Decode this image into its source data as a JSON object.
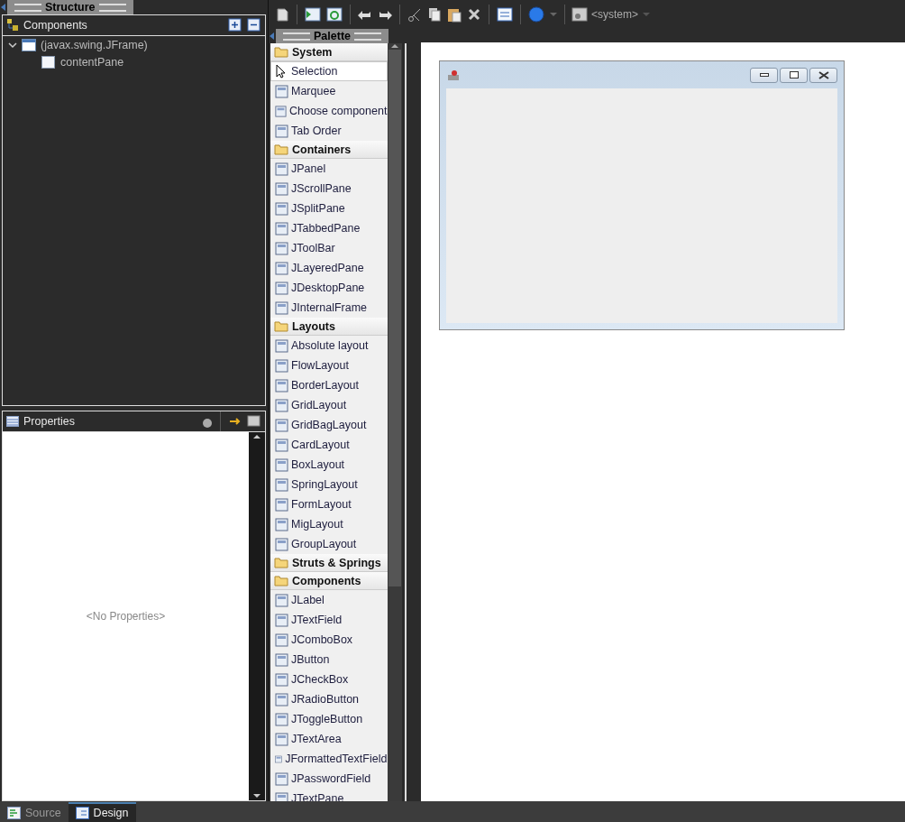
{
  "structure": {
    "title": "Structure",
    "components_title": "Components",
    "tree": [
      {
        "label": "(javax.swing.JFrame)",
        "expanded": true,
        "children": [
          {
            "label": "contentPane"
          }
        ]
      }
    ]
  },
  "properties": {
    "title": "Properties",
    "empty_text": "<No Properties>"
  },
  "toolbar": {
    "look_and_feel": "<system>"
  },
  "palette": {
    "title": "Palette",
    "groups": [
      {
        "label": "System",
        "items": [
          {
            "label": "Selection",
            "selected": true
          },
          {
            "label": "Marquee",
            "selected": false
          },
          {
            "label": "Choose component",
            "selected": false
          },
          {
            "label": "Tab Order",
            "selected": false
          }
        ]
      },
      {
        "label": "Containers",
        "items": [
          {
            "label": "JPanel",
            "selected": false
          },
          {
            "label": "JScrollPane",
            "selected": false
          },
          {
            "label": "JSplitPane",
            "selected": false
          },
          {
            "label": "JTabbedPane",
            "selected": false
          },
          {
            "label": "JToolBar",
            "selected": false
          },
          {
            "label": "JLayeredPane",
            "selected": false
          },
          {
            "label": "JDesktopPane",
            "selected": false
          },
          {
            "label": "JInternalFrame",
            "selected": false
          }
        ]
      },
      {
        "label": "Layouts",
        "items": [
          {
            "label": "Absolute layout",
            "selected": false
          },
          {
            "label": "FlowLayout",
            "selected": false
          },
          {
            "label": "BorderLayout",
            "selected": false
          },
          {
            "label": "GridLayout",
            "selected": false
          },
          {
            "label": "GridBagLayout",
            "selected": false
          },
          {
            "label": "CardLayout",
            "selected": false
          },
          {
            "label": "BoxLayout",
            "selected": false
          },
          {
            "label": "SpringLayout",
            "selected": false
          },
          {
            "label": "FormLayout",
            "selected": false
          },
          {
            "label": "MigLayout",
            "selected": false
          },
          {
            "label": "GroupLayout",
            "selected": false
          }
        ]
      },
      {
        "label": "Struts & Springs"
      },
      {
        "label": "Components",
        "items": [
          {
            "label": "JLabel",
            "selected": false
          },
          {
            "label": "JTextField",
            "selected": false
          },
          {
            "label": "JComboBox",
            "selected": false
          },
          {
            "label": "JButton",
            "selected": false
          },
          {
            "label": "JCheckBox",
            "selected": false
          },
          {
            "label": "JRadioButton",
            "selected": false
          },
          {
            "label": "JToggleButton",
            "selected": false
          },
          {
            "label": "JTextArea",
            "selected": false
          },
          {
            "label": "JFormattedTextField",
            "selected": false
          },
          {
            "label": "JPasswordField",
            "selected": false
          },
          {
            "label": "JTextPane",
            "selected": false
          }
        ]
      }
    ]
  },
  "editor_tabs": [
    {
      "label": "Source",
      "selected": false
    },
    {
      "label": "Design",
      "selected": true
    }
  ]
}
